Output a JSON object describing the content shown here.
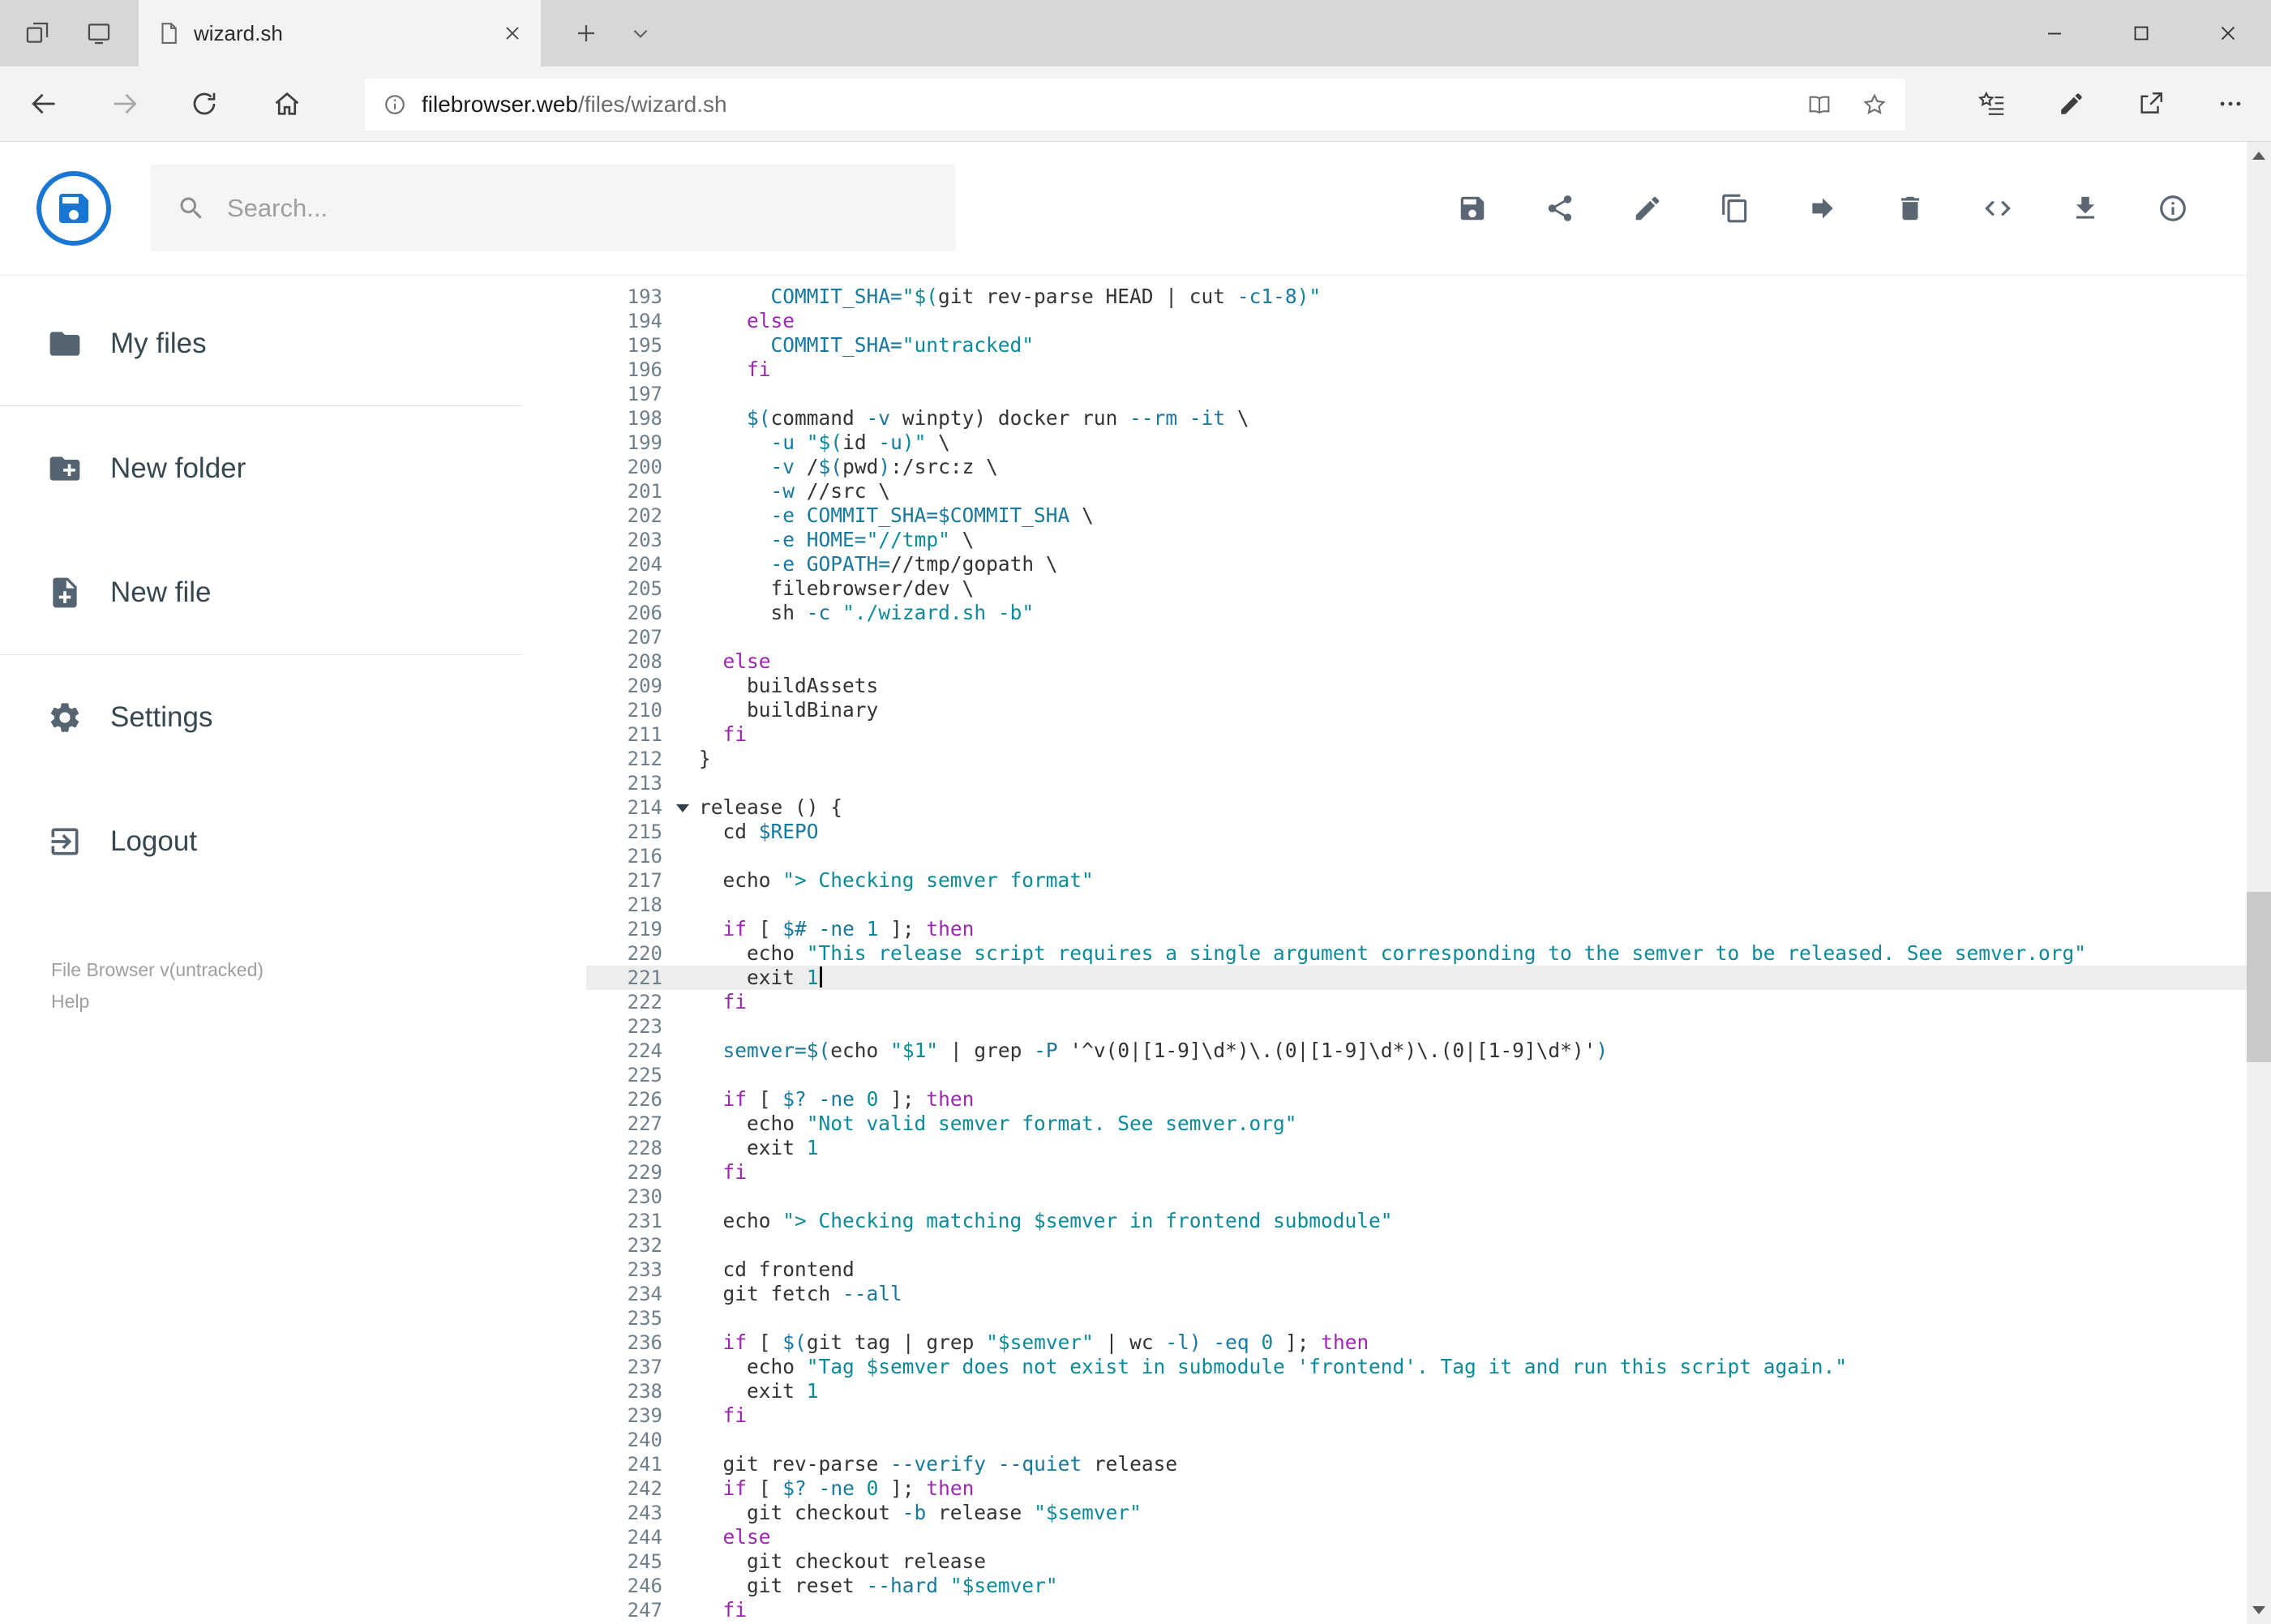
{
  "browser": {
    "tab_title": "wizard.sh",
    "url_host": "filebrowser.web",
    "url_path": "/files/wizard.sh"
  },
  "app": {
    "search": {
      "placeholder": "Search..."
    },
    "toolbar": {
      "buttons": [
        {
          "name": "save-button",
          "icon": "save-icon"
        },
        {
          "name": "share-button",
          "icon": "share-icon"
        },
        {
          "name": "rename-button",
          "icon": "edit-icon"
        },
        {
          "name": "copy-button",
          "icon": "copy-icon"
        },
        {
          "name": "move-button",
          "icon": "move-icon"
        },
        {
          "name": "delete-button",
          "icon": "delete-icon"
        },
        {
          "name": "code-view-button",
          "icon": "code-icon"
        },
        {
          "name": "download-button",
          "icon": "download-icon"
        },
        {
          "name": "info-button",
          "icon": "info-icon"
        }
      ]
    },
    "sidebar": {
      "items": [
        {
          "name": "my-files",
          "label": "My files",
          "icon": "folder-icon",
          "divider_after": true
        },
        {
          "name": "new-folder",
          "label": "New folder",
          "icon": "new-folder-icon",
          "divider_after": false
        },
        {
          "name": "new-file",
          "label": "New file",
          "icon": "new-file-icon",
          "divider_after": true
        },
        {
          "name": "settings",
          "label": "Settings",
          "icon": "settings-icon",
          "divider_after": false
        },
        {
          "name": "logout",
          "label": "Logout",
          "icon": "logout-icon",
          "divider_after": false
        }
      ],
      "footer": {
        "version": "File Browser v(untracked)",
        "help": "Help"
      }
    }
  },
  "colors": {
    "accent_blue": "#1976d2",
    "keyword": "#9c27b0",
    "string": "#0d8a99",
    "variable": "#19789d",
    "number": "#0d8a99",
    "plain": "#333333",
    "line_number": "#6e7f8a",
    "active_line_bg": "#ededed"
  },
  "editor": {
    "active_line": 221,
    "fold_marker_line": 214,
    "lines": [
      {
        "n": 193,
        "t": [
          [
            "      ",
            "p"
          ],
          [
            "COMMIT_SHA=",
            "v"
          ],
          [
            "\"$(",
            "s"
          ],
          [
            "git rev-parse HEAD | cut ",
            "p"
          ],
          [
            "-c1-8",
            "v"
          ],
          [
            ")\"",
            "s"
          ]
        ]
      },
      {
        "n": 194,
        "t": [
          [
            "    ",
            "p"
          ],
          [
            "else",
            "k"
          ]
        ]
      },
      {
        "n": 195,
        "t": [
          [
            "      ",
            "p"
          ],
          [
            "COMMIT_SHA=",
            "v"
          ],
          [
            "\"untracked\"",
            "s"
          ]
        ]
      },
      {
        "n": 196,
        "t": [
          [
            "    ",
            "p"
          ],
          [
            "fi",
            "k"
          ]
        ]
      },
      {
        "n": 197,
        "t": []
      },
      {
        "n": 198,
        "t": [
          [
            "    ",
            "p"
          ],
          [
            "$(",
            "v"
          ],
          [
            "command ",
            "p"
          ],
          [
            "-v",
            "v"
          ],
          [
            " winpty) docker run ",
            "p"
          ],
          [
            "--rm",
            "v"
          ],
          [
            " ",
            "p"
          ],
          [
            "-it",
            "v"
          ],
          [
            " \\",
            "p"
          ]
        ]
      },
      {
        "n": 199,
        "t": [
          [
            "      ",
            "p"
          ],
          [
            "-u",
            "v"
          ],
          [
            " ",
            "p"
          ],
          [
            "\"$(",
            "s"
          ],
          [
            "id ",
            "p"
          ],
          [
            "-u",
            "v"
          ],
          [
            ")\"",
            "s"
          ],
          [
            " \\",
            "p"
          ]
        ]
      },
      {
        "n": 200,
        "t": [
          [
            "      ",
            "p"
          ],
          [
            "-v",
            "v"
          ],
          [
            " /",
            "p"
          ],
          [
            "$(",
            "v"
          ],
          [
            "pwd",
            "p"
          ],
          [
            ")",
            "v"
          ],
          [
            ":/src:z \\",
            "p"
          ]
        ]
      },
      {
        "n": 201,
        "t": [
          [
            "      ",
            "p"
          ],
          [
            "-w",
            "v"
          ],
          [
            " //src \\",
            "p"
          ]
        ]
      },
      {
        "n": 202,
        "t": [
          [
            "      ",
            "p"
          ],
          [
            "-e",
            "v"
          ],
          [
            " ",
            "p"
          ],
          [
            "COMMIT_SHA=$COMMIT_SHA",
            "v"
          ],
          [
            " \\",
            "p"
          ]
        ]
      },
      {
        "n": 203,
        "t": [
          [
            "      ",
            "p"
          ],
          [
            "-e",
            "v"
          ],
          [
            " ",
            "p"
          ],
          [
            "HOME=",
            "v"
          ],
          [
            "\"//tmp\"",
            "s"
          ],
          [
            " \\",
            "p"
          ]
        ]
      },
      {
        "n": 204,
        "t": [
          [
            "      ",
            "p"
          ],
          [
            "-e",
            "v"
          ],
          [
            " ",
            "p"
          ],
          [
            "GOPATH=",
            "v"
          ],
          [
            "//tmp/gopath \\",
            "p"
          ]
        ]
      },
      {
        "n": 205,
        "t": [
          [
            "      ",
            "p"
          ],
          [
            "filebrowser/dev \\",
            "p"
          ]
        ]
      },
      {
        "n": 206,
        "t": [
          [
            "      ",
            "p"
          ],
          [
            "sh ",
            "p"
          ],
          [
            "-c",
            "v"
          ],
          [
            " ",
            "p"
          ],
          [
            "\"./wizard.sh -b\"",
            "s"
          ]
        ]
      },
      {
        "n": 207,
        "t": []
      },
      {
        "n": 208,
        "t": [
          [
            "  ",
            "p"
          ],
          [
            "else",
            "k"
          ]
        ]
      },
      {
        "n": 209,
        "t": [
          [
            "    ",
            "p"
          ],
          [
            "buildAssets",
            "p"
          ]
        ]
      },
      {
        "n": 210,
        "t": [
          [
            "    ",
            "p"
          ],
          [
            "buildBinary",
            "p"
          ]
        ]
      },
      {
        "n": 211,
        "t": [
          [
            "  ",
            "p"
          ],
          [
            "fi",
            "k"
          ]
        ]
      },
      {
        "n": 212,
        "t": [
          [
            "}",
            "p"
          ]
        ]
      },
      {
        "n": 213,
        "t": []
      },
      {
        "n": 214,
        "fold": true,
        "t": [
          [
            "release () {",
            "p"
          ]
        ]
      },
      {
        "n": 215,
        "t": [
          [
            "  ",
            "p"
          ],
          [
            "cd ",
            "p"
          ],
          [
            "$REPO",
            "v"
          ]
        ]
      },
      {
        "n": 216,
        "t": []
      },
      {
        "n": 217,
        "t": [
          [
            "  ",
            "p"
          ],
          [
            "echo ",
            "p"
          ],
          [
            "\"> Checking semver format\"",
            "s"
          ]
        ]
      },
      {
        "n": 218,
        "t": []
      },
      {
        "n": 219,
        "t": [
          [
            "  ",
            "p"
          ],
          [
            "if",
            "k"
          ],
          [
            " [ ",
            "p"
          ],
          [
            "$#",
            "v"
          ],
          [
            " ",
            "p"
          ],
          [
            "-ne",
            "v"
          ],
          [
            " ",
            "p"
          ],
          [
            "1",
            "n"
          ],
          [
            " ]; ",
            "p"
          ],
          [
            "then",
            "k"
          ]
        ]
      },
      {
        "n": 220,
        "t": [
          [
            "    ",
            "p"
          ],
          [
            "echo ",
            "p"
          ],
          [
            "\"This release script requires a single argument corresponding to the semver to be released. See semver.org\"",
            "s"
          ]
        ]
      },
      {
        "n": 221,
        "active": true,
        "cursor": true,
        "t": [
          [
            "    ",
            "p"
          ],
          [
            "exit ",
            "p"
          ],
          [
            "1",
            "n"
          ]
        ]
      },
      {
        "n": 222,
        "t": [
          [
            "  ",
            "p"
          ],
          [
            "fi",
            "k"
          ]
        ]
      },
      {
        "n": 223,
        "t": []
      },
      {
        "n": 224,
        "t": [
          [
            "  ",
            "p"
          ],
          [
            "semver=",
            "v"
          ],
          [
            "$(",
            "v"
          ],
          [
            "echo ",
            "p"
          ],
          [
            "\"$1\"",
            "s"
          ],
          [
            " | grep ",
            "p"
          ],
          [
            "-P",
            "v"
          ],
          [
            " ",
            "p"
          ],
          [
            "'^v(0|[1-9]\\d*)\\.(0|[1-9]\\d*)\\.(0|[1-9]\\d*)'",
            "p"
          ],
          [
            ")",
            "v"
          ]
        ]
      },
      {
        "n": 225,
        "t": []
      },
      {
        "n": 226,
        "t": [
          [
            "  ",
            "p"
          ],
          [
            "if",
            "k"
          ],
          [
            " [ ",
            "p"
          ],
          [
            "$?",
            "v"
          ],
          [
            " ",
            "p"
          ],
          [
            "-ne",
            "v"
          ],
          [
            " ",
            "p"
          ],
          [
            "0",
            "n"
          ],
          [
            " ]; ",
            "p"
          ],
          [
            "then",
            "k"
          ]
        ]
      },
      {
        "n": 227,
        "t": [
          [
            "    ",
            "p"
          ],
          [
            "echo ",
            "p"
          ],
          [
            "\"Not valid semver format. See semver.org\"",
            "s"
          ]
        ]
      },
      {
        "n": 228,
        "t": [
          [
            "    ",
            "p"
          ],
          [
            "exit ",
            "p"
          ],
          [
            "1",
            "n"
          ]
        ]
      },
      {
        "n": 229,
        "t": [
          [
            "  ",
            "p"
          ],
          [
            "fi",
            "k"
          ]
        ]
      },
      {
        "n": 230,
        "t": []
      },
      {
        "n": 231,
        "t": [
          [
            "  ",
            "p"
          ],
          [
            "echo ",
            "p"
          ],
          [
            "\"> Checking matching $semver in frontend submodule\"",
            "s"
          ]
        ]
      },
      {
        "n": 232,
        "t": []
      },
      {
        "n": 233,
        "t": [
          [
            "  ",
            "p"
          ],
          [
            "cd frontend",
            "p"
          ]
        ]
      },
      {
        "n": 234,
        "t": [
          [
            "  ",
            "p"
          ],
          [
            "git fetch ",
            "p"
          ],
          [
            "--all",
            "v"
          ]
        ]
      },
      {
        "n": 235,
        "t": []
      },
      {
        "n": 236,
        "t": [
          [
            "  ",
            "p"
          ],
          [
            "if",
            "k"
          ],
          [
            " [ ",
            "p"
          ],
          [
            "$(",
            "v"
          ],
          [
            "git tag | grep ",
            "p"
          ],
          [
            "\"$semver\"",
            "s"
          ],
          [
            " | wc ",
            "p"
          ],
          [
            "-l",
            "v"
          ],
          [
            ")",
            "v"
          ],
          [
            " ",
            "p"
          ],
          [
            "-eq",
            "v"
          ],
          [
            " ",
            "p"
          ],
          [
            "0",
            "n"
          ],
          [
            " ]; ",
            "p"
          ],
          [
            "then",
            "k"
          ]
        ]
      },
      {
        "n": 237,
        "t": [
          [
            "    ",
            "p"
          ],
          [
            "echo ",
            "p"
          ],
          [
            "\"Tag $semver does not exist in submodule 'frontend'. Tag it and run this script again.\"",
            "s"
          ]
        ]
      },
      {
        "n": 238,
        "t": [
          [
            "    ",
            "p"
          ],
          [
            "exit ",
            "p"
          ],
          [
            "1",
            "n"
          ]
        ]
      },
      {
        "n": 239,
        "t": [
          [
            "  ",
            "p"
          ],
          [
            "fi",
            "k"
          ]
        ]
      },
      {
        "n": 240,
        "t": []
      },
      {
        "n": 241,
        "t": [
          [
            "  ",
            "p"
          ],
          [
            "git rev-parse ",
            "p"
          ],
          [
            "--verify",
            "v"
          ],
          [
            " ",
            "p"
          ],
          [
            "--quiet",
            "v"
          ],
          [
            " release",
            "p"
          ]
        ]
      },
      {
        "n": 242,
        "t": [
          [
            "  ",
            "p"
          ],
          [
            "if",
            "k"
          ],
          [
            " [ ",
            "p"
          ],
          [
            "$?",
            "v"
          ],
          [
            " ",
            "p"
          ],
          [
            "-ne",
            "v"
          ],
          [
            " ",
            "p"
          ],
          [
            "0",
            "n"
          ],
          [
            " ]; ",
            "p"
          ],
          [
            "then",
            "k"
          ]
        ]
      },
      {
        "n": 243,
        "t": [
          [
            "    ",
            "p"
          ],
          [
            "git checkout ",
            "p"
          ],
          [
            "-b",
            "v"
          ],
          [
            " release ",
            "p"
          ],
          [
            "\"$semver\"",
            "s"
          ]
        ]
      },
      {
        "n": 244,
        "t": [
          [
            "  ",
            "p"
          ],
          [
            "else",
            "k"
          ]
        ]
      },
      {
        "n": 245,
        "t": [
          [
            "    ",
            "p"
          ],
          [
            "git checkout release",
            "p"
          ]
        ]
      },
      {
        "n": 246,
        "t": [
          [
            "    ",
            "p"
          ],
          [
            "git reset ",
            "p"
          ],
          [
            "--hard",
            "v"
          ],
          [
            " ",
            "p"
          ],
          [
            "\"$semver\"",
            "s"
          ]
        ]
      },
      {
        "n": 247,
        "t": [
          [
            "  ",
            "p"
          ],
          [
            "fi",
            "k"
          ]
        ]
      }
    ]
  }
}
